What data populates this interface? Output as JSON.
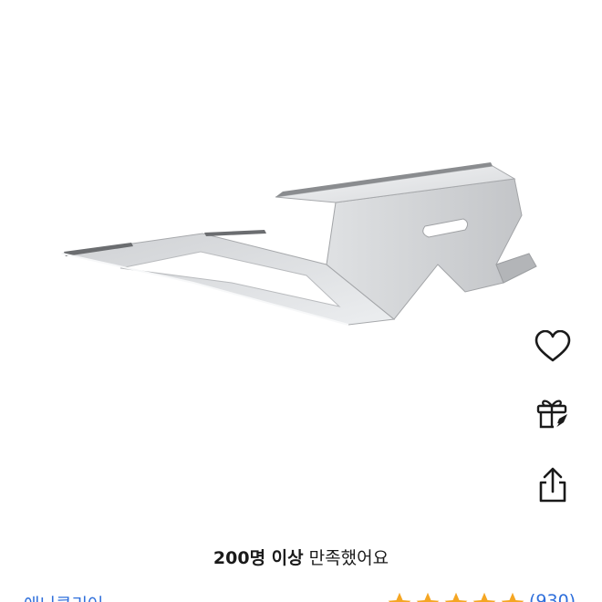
{
  "product": {
    "image_alt": "aluminum laptop stand",
    "image_colors": {
      "metal_light": "#e9eaec",
      "metal_mid": "#c9cbce",
      "metal_dark": "#a9abae",
      "edge": "#8e9093"
    }
  },
  "actions": [
    {
      "name": "wishlist",
      "icon": "heart-icon"
    },
    {
      "name": "gift",
      "icon": "gift-icon"
    },
    {
      "name": "share",
      "icon": "share-icon"
    }
  ],
  "satisfaction": {
    "highlight": "200명 이상",
    "rest": " 만족했어요"
  },
  "bottom": {
    "seller": "애니클리어",
    "rating_stars": 5,
    "review_count": "(930)"
  },
  "colors": {
    "link": "#2f6fdb",
    "star": "#f5a623",
    "icon": "#1a1a1a"
  }
}
